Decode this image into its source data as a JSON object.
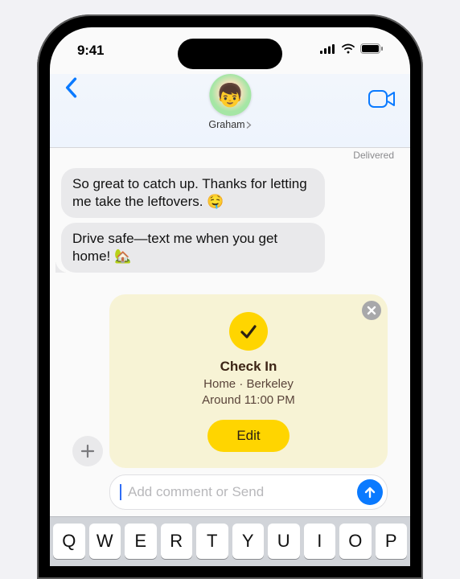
{
  "status": {
    "time": "9:41"
  },
  "header": {
    "contact_name": "Graham",
    "avatar_emoji": "👦"
  },
  "delivered_label": "Delivered",
  "messages": [
    {
      "text": "So great to catch up. Thanks for letting me take the leftovers. 🤤"
    },
    {
      "text": "Drive safe—text me when you get home! 🏡"
    }
  ],
  "checkin": {
    "title": "Check In",
    "location": "Home · Berkeley",
    "time": "Around 11:00 PM",
    "edit_label": "Edit"
  },
  "compose": {
    "placeholder": "Add comment or Send"
  },
  "keyboard_row": [
    "Q",
    "W",
    "E",
    "R",
    "T",
    "Y",
    "U",
    "I",
    "O",
    "P"
  ]
}
